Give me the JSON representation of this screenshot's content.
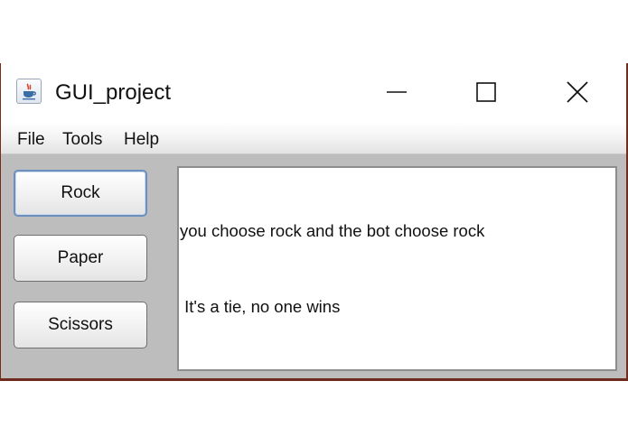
{
  "window": {
    "title": "GUI_project",
    "icon": "java-cup-icon",
    "controls": [
      "minimize-icon",
      "maximize-icon",
      "close-icon"
    ]
  },
  "menubar": {
    "items": [
      {
        "label": "File"
      },
      {
        "label": "Tools"
      },
      {
        "label": "Help"
      }
    ]
  },
  "buttons": {
    "rock": "Rock",
    "paper": "Paper",
    "scissors": "Scissors"
  },
  "output": {
    "lines": [
      "you choose rock and the bot choose rock",
      " It's a tie, no one wins"
    ]
  },
  "colors": {
    "frame_border": "#7a2a1a",
    "content_bg": "#bdbdbd",
    "focus_border": "#6d8fbe"
  }
}
